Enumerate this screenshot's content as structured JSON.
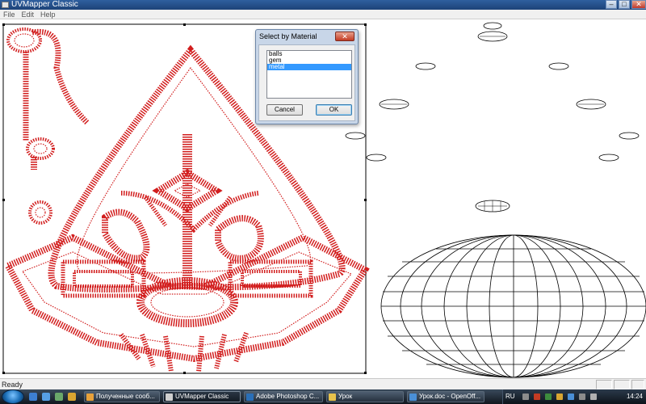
{
  "window": {
    "title": "UVMapper Classic",
    "controls": {
      "minimize": "‒",
      "maximize": "□",
      "close": "✕"
    }
  },
  "menu": [
    "File",
    "Edit",
    "Help"
  ],
  "status": {
    "text": "Ready"
  },
  "dialog": {
    "title": "Select by Material",
    "close": "✕",
    "materials": [
      "balls",
      "gem",
      "metal"
    ],
    "selected_index": 2,
    "cancel_label": "Cancel",
    "ok_label": "OK"
  },
  "canvas": {
    "wireframe_color_selected": "#d21e1e",
    "wireframe_color_normal": "#000000"
  },
  "taskbar": {
    "start_icon": "windows-start-orb",
    "items": [
      {
        "label": "Полученные сооб...",
        "icon": "mail-icon",
        "color": "#e8a13a",
        "active": false
      },
      {
        "label": "UVMapper Classic",
        "icon": "app-icon",
        "color": "#cfcfcf",
        "active": true
      },
      {
        "label": "Adobe Photoshop C...",
        "icon": "photoshop-icon",
        "color": "#2a6fb8",
        "active": false
      },
      {
        "label": "Урок",
        "icon": "folder-icon",
        "color": "#e7c24c",
        "active": false
      },
      {
        "label": "Урок.doc - OpenOff...",
        "icon": "document-icon",
        "color": "#4a8fd6",
        "active": false
      }
    ],
    "tray": {
      "language": "RU",
      "clock": "14:24"
    }
  }
}
